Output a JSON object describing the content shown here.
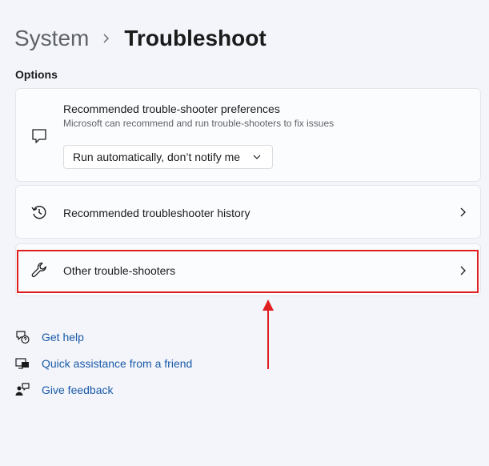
{
  "header": {
    "parent": "System",
    "current": "Troubleshoot"
  },
  "section": {
    "label": "Options"
  },
  "cards": {
    "preferences": {
      "title": "Recommended trouble-shooter preferences",
      "subtitle": "Microsoft can recommend and run trouble-shooters to fix issues",
      "dropdown_value": "Run automatically, don’t notify me",
      "icon": "chat-bubble-icon"
    },
    "history": {
      "title": "Recommended troubleshooter history",
      "icon": "history-icon"
    },
    "other": {
      "title": "Other trouble-shooters",
      "icon": "wrench-icon"
    }
  },
  "links": [
    {
      "label": "Get help",
      "icon": "help-icon"
    },
    {
      "label": "Quick assistance from a friend",
      "icon": "remote-assist-icon"
    },
    {
      "label": "Give feedback",
      "icon": "feedback-icon"
    }
  ],
  "colors": {
    "background": "#f3f5fa",
    "card": "#fbfcfe",
    "link": "#1a5aa8",
    "annotation": "#e02020"
  }
}
